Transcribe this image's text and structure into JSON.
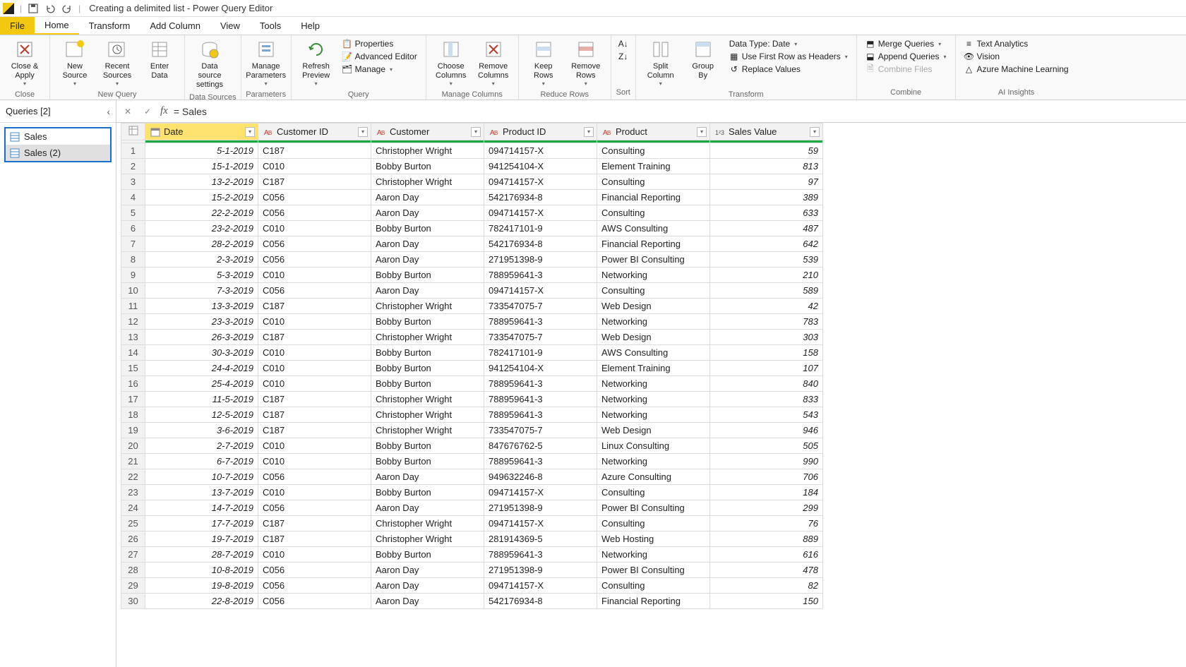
{
  "titlebar": {
    "title": "Creating a delimited list - Power Query Editor"
  },
  "menu": {
    "file": "File",
    "tabs": [
      "Home",
      "Transform",
      "Add Column",
      "View",
      "Tools",
      "Help"
    ],
    "active": "Home"
  },
  "ribbon": {
    "close_group": {
      "close_apply": "Close &\nApply",
      "label": "Close"
    },
    "newquery_group": {
      "new_source": "New\nSource",
      "recent_sources": "Recent\nSources",
      "enter_data": "Enter\nData",
      "label": "New Query"
    },
    "datasources_group": {
      "data_source_settings": "Data source\nsettings",
      "label": "Data Sources"
    },
    "parameters_group": {
      "manage_parameters": "Manage\nParameters",
      "label": "Parameters"
    },
    "query_group": {
      "refresh_preview": "Refresh\nPreview",
      "properties": "Properties",
      "advanced_editor": "Advanced Editor",
      "manage": "Manage",
      "label": "Query"
    },
    "managecols_group": {
      "choose_columns": "Choose\nColumns",
      "remove_columns": "Remove\nColumns",
      "label": "Manage Columns"
    },
    "reducerows_group": {
      "keep_rows": "Keep\nRows",
      "remove_rows": "Remove\nRows",
      "label": "Reduce Rows"
    },
    "sort_group": {
      "label": "Sort"
    },
    "transform_group": {
      "split_column": "Split\nColumn",
      "group_by": "Group\nBy",
      "data_type": "Data Type: Date",
      "first_row_headers": "Use First Row as Headers",
      "replace_values": "Replace Values",
      "label": "Transform"
    },
    "combine_group": {
      "merge": "Merge Queries",
      "append": "Append Queries",
      "combine_files": "Combine Files",
      "label": "Combine"
    },
    "ai_group": {
      "text_analytics": "Text Analytics",
      "vision": "Vision",
      "azure_ml": "Azure Machine Learning",
      "label": "AI Insights"
    }
  },
  "queries": {
    "header": "Queries [2]",
    "items": [
      {
        "name": "Sales"
      },
      {
        "name": "Sales (2)"
      }
    ]
  },
  "formula": "= Sales",
  "grid": {
    "columns": [
      {
        "name": "Date",
        "type": "date"
      },
      {
        "name": "Customer ID",
        "type": "text"
      },
      {
        "name": "Customer",
        "type": "text"
      },
      {
        "name": "Product ID",
        "type": "text"
      },
      {
        "name": "Product",
        "type": "text"
      },
      {
        "name": "Sales Value",
        "type": "number"
      }
    ],
    "rows": [
      [
        "5-1-2019",
        "C187",
        "Christopher Wright",
        "094714157-X",
        "Consulting",
        "59"
      ],
      [
        "15-1-2019",
        "C010",
        "Bobby Burton",
        "941254104-X",
        "Element Training",
        "813"
      ],
      [
        "13-2-2019",
        "C187",
        "Christopher Wright",
        "094714157-X",
        "Consulting",
        "97"
      ],
      [
        "15-2-2019",
        "C056",
        "Aaron Day",
        "542176934-8",
        "Financial Reporting",
        "389"
      ],
      [
        "22-2-2019",
        "C056",
        "Aaron Day",
        "094714157-X",
        "Consulting",
        "633"
      ],
      [
        "23-2-2019",
        "C010",
        "Bobby Burton",
        "782417101-9",
        "AWS Consulting",
        "487"
      ],
      [
        "28-2-2019",
        "C056",
        "Aaron Day",
        "542176934-8",
        "Financial Reporting",
        "642"
      ],
      [
        "2-3-2019",
        "C056",
        "Aaron Day",
        "271951398-9",
        "Power BI Consulting",
        "539"
      ],
      [
        "5-3-2019",
        "C010",
        "Bobby Burton",
        "788959641-3",
        "Networking",
        "210"
      ],
      [
        "7-3-2019",
        "C056",
        "Aaron Day",
        "094714157-X",
        "Consulting",
        "589"
      ],
      [
        "13-3-2019",
        "C187",
        "Christopher Wright",
        "733547075-7",
        "Web Design",
        "42"
      ],
      [
        "23-3-2019",
        "C010",
        "Bobby Burton",
        "788959641-3",
        "Networking",
        "783"
      ],
      [
        "26-3-2019",
        "C187",
        "Christopher Wright",
        "733547075-7",
        "Web Design",
        "303"
      ],
      [
        "30-3-2019",
        "C010",
        "Bobby Burton",
        "782417101-9",
        "AWS Consulting",
        "158"
      ],
      [
        "24-4-2019",
        "C010",
        "Bobby Burton",
        "941254104-X",
        "Element Training",
        "107"
      ],
      [
        "25-4-2019",
        "C010",
        "Bobby Burton",
        "788959641-3",
        "Networking",
        "840"
      ],
      [
        "11-5-2019",
        "C187",
        "Christopher Wright",
        "788959641-3",
        "Networking",
        "833"
      ],
      [
        "12-5-2019",
        "C187",
        "Christopher Wright",
        "788959641-3",
        "Networking",
        "543"
      ],
      [
        "3-6-2019",
        "C187",
        "Christopher Wright",
        "733547075-7",
        "Web Design",
        "946"
      ],
      [
        "2-7-2019",
        "C010",
        "Bobby Burton",
        "847676762-5",
        "Linux Consulting",
        "505"
      ],
      [
        "6-7-2019",
        "C010",
        "Bobby Burton",
        "788959641-3",
        "Networking",
        "990"
      ],
      [
        "10-7-2019",
        "C056",
        "Aaron Day",
        "949632246-8",
        "Azure Consulting",
        "706"
      ],
      [
        "13-7-2019",
        "C010",
        "Bobby Burton",
        "094714157-X",
        "Consulting",
        "184"
      ],
      [
        "14-7-2019",
        "C056",
        "Aaron Day",
        "271951398-9",
        "Power BI Consulting",
        "299"
      ],
      [
        "17-7-2019",
        "C187",
        "Christopher Wright",
        "094714157-X",
        "Consulting",
        "76"
      ],
      [
        "19-7-2019",
        "C187",
        "Christopher Wright",
        "281914369-5",
        "Web Hosting",
        "889"
      ],
      [
        "28-7-2019",
        "C010",
        "Bobby Burton",
        "788959641-3",
        "Networking",
        "616"
      ],
      [
        "10-8-2019",
        "C056",
        "Aaron Day",
        "271951398-9",
        "Power BI Consulting",
        "478"
      ],
      [
        "19-8-2019",
        "C056",
        "Aaron Day",
        "094714157-X",
        "Consulting",
        "82"
      ],
      [
        "22-8-2019",
        "C056",
        "Aaron Day",
        "542176934-8",
        "Financial Reporting",
        "150"
      ]
    ]
  }
}
